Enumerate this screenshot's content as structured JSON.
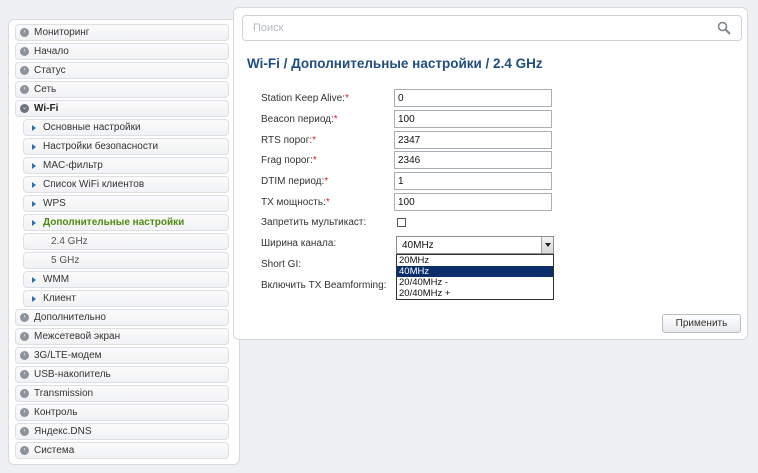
{
  "sidebar": {
    "items": [
      {
        "label": "Мониторинг"
      },
      {
        "label": "Начало"
      },
      {
        "label": "Статус"
      },
      {
        "label": "Сеть"
      },
      {
        "label": "Wi-Fi"
      },
      {
        "label": "Основные настройки"
      },
      {
        "label": "Настройки безопасности"
      },
      {
        "label": "MAC-фильтр"
      },
      {
        "label": "Список WiFi клиентов"
      },
      {
        "label": "WPS"
      },
      {
        "label": "Дополнительные настройки"
      },
      {
        "label": "2.4 GHz"
      },
      {
        "label": "5 GHz"
      },
      {
        "label": "WMM"
      },
      {
        "label": "Клиент"
      },
      {
        "label": "Дополнительно"
      },
      {
        "label": "Межсетевой экран"
      },
      {
        "label": "3G/LTE-модем"
      },
      {
        "label": "USB-накопитель"
      },
      {
        "label": "Transmission"
      },
      {
        "label": "Контроль"
      },
      {
        "label": "Яндекс.DNS"
      },
      {
        "label": "Система"
      }
    ]
  },
  "search": {
    "placeholder": "Поиск",
    "icon": "search-icon"
  },
  "page": {
    "title": "Wi-Fi /  Дополнительные настройки /  2.4 GHz"
  },
  "form": {
    "station_keep_alive": {
      "label": "Station Keep Alive:",
      "required": "*",
      "value": "0"
    },
    "beacon_period": {
      "label": "Beacon период:",
      "required": "*",
      "value": "100"
    },
    "rts_threshold": {
      "label": "RTS порог:",
      "required": "*",
      "value": "2347"
    },
    "frag_threshold": {
      "label": "Frag порог:",
      "required": "*",
      "value": "2346"
    },
    "dtim_period": {
      "label": "DTIM период:",
      "required": "*",
      "value": "1"
    },
    "tx_power": {
      "label": "TX мощность:",
      "required": "*",
      "value": "100"
    },
    "disable_multicast": {
      "label": "Запретить мультикаст:"
    },
    "channel_width": {
      "label": "Ширина канала:",
      "value": "40MHz",
      "options": [
        "20MHz",
        "40MHz",
        "20/40MHz -",
        "20/40MHz +"
      ]
    },
    "short_gi": {
      "label": "Short GI:"
    },
    "tx_beamforming": {
      "label": "Включить TX Beamforming:"
    }
  },
  "actions": {
    "apply_label": "Применить"
  },
  "colors": {
    "title": "#1f4e82",
    "active_menu": "#4f8a10",
    "required": "#d8232a",
    "dropdown_selected": "#0b2e6b"
  }
}
